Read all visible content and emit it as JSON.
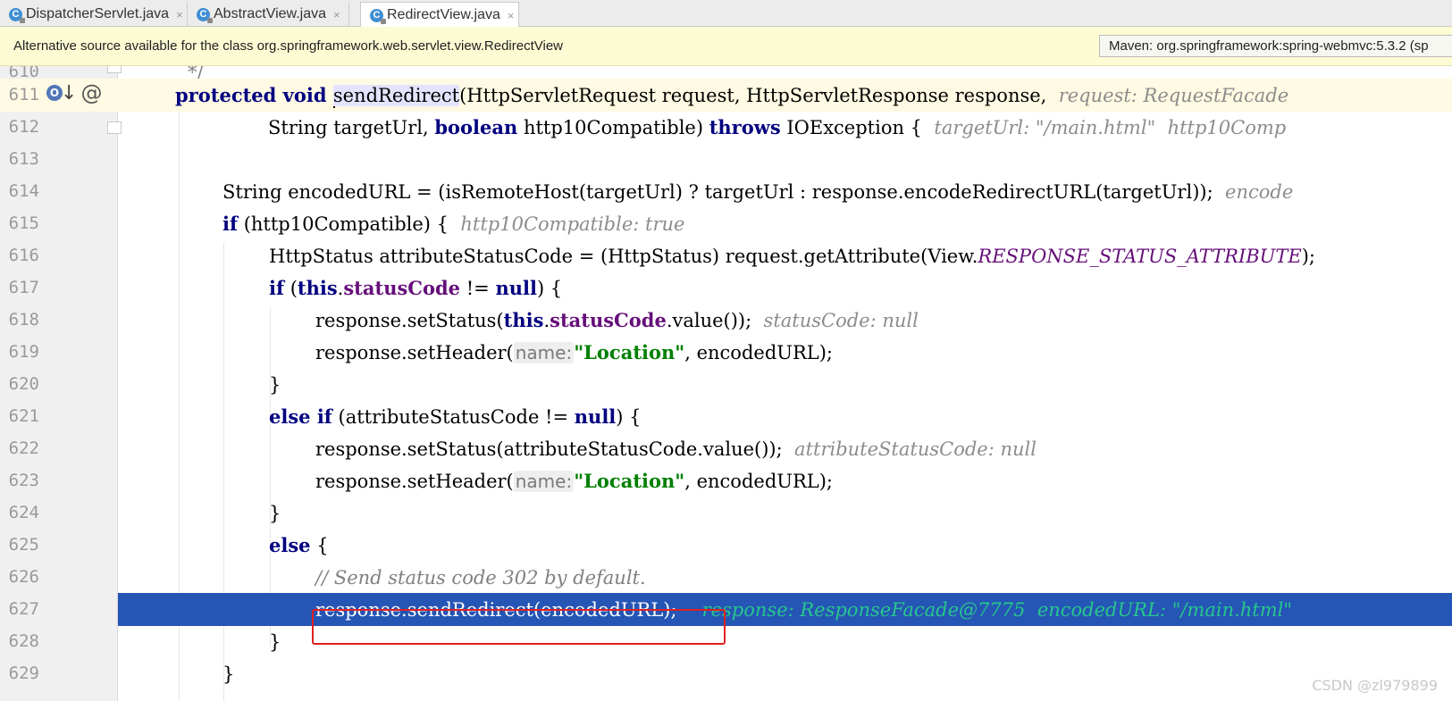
{
  "tabs": [
    {
      "label": "DispatcherServlet.java",
      "icon": "class-icon",
      "active": false
    },
    {
      "label": "AbstractView.java",
      "icon": "class-icon",
      "active": false
    },
    {
      "label": "RedirectView.java",
      "icon": "class-icon",
      "active": true
    }
  ],
  "tab_icon_letter": "C",
  "tab_close_glyph": "×",
  "banner": {
    "message": "Alternative source available for the class org.springframework.web.servlet.view.RedirectView",
    "source_option": "Maven: org.springframework:spring-webmvc:5.3.2 (sp"
  },
  "gutter": {
    "line_numbers": [
      "610",
      "611",
      "612",
      "613",
      "614",
      "615",
      "616",
      "617",
      "618",
      "619",
      "620",
      "621",
      "622",
      "623",
      "624",
      "625",
      "626",
      "627",
      "628",
      "629"
    ],
    "override_icon_letter": "O",
    "override_arrow": "↓",
    "annotation_symbol": "@"
  },
  "code": {
    "l610": "*/",
    "l611_kw": "protected void ",
    "l611_method": "sendRedirect",
    "l611_rest": "(HttpServletRequest request, HttpServletResponse response,  ",
    "l611_hint": "request: RequestFacade",
    "l612_a": "String targetUrl, ",
    "l612_kw1": "boolean",
    "l612_b": " http10Compatible) ",
    "l612_kw2": "throws",
    "l612_c": " IOException {  ",
    "l612_hint": "targetUrl: \"/main.html\"  http10Comp",
    "l614": "String encodedURL = (isRemoteHost(targetUrl) ? targetUrl : response.encodeRedirectURL(targetUrl));  ",
    "l614_hint": "encode",
    "l615_kw": "if",
    "l615_rest": " (http10Compatible) {  ",
    "l615_hint": "http10Compatible: true",
    "l616_a": "HttpStatus attributeStatusCode = (HttpStatus) request.getAttribute(View.",
    "l616_const": "RESPONSE_STATUS_ATTRIBUTE",
    "l616_b": ");",
    "l617_kw": "if",
    "l617_a": " (",
    "l617_this": "this",
    "l617_dot": ".",
    "l617_field": "statusCode",
    "l617_b": " != ",
    "l617_null": "null",
    "l617_c": ") {",
    "l618_a": "response.setStatus(",
    "l618_this": "this",
    "l618_dot": ".",
    "l618_field": "statusCode",
    "l618_b": ".value());  ",
    "l618_hint": "statusCode: null",
    "set_header_a": "response.setHeader(",
    "param_hint": "name:",
    "location_str": "\"Location\"",
    "set_header_b": ", encodedURL);",
    "close_brace": "}",
    "l621_kw": "else if",
    "l621_a": " (attributeStatusCode != ",
    "l621_null": "null",
    "l621_b": ") {",
    "l622": "response.setStatus(attributeStatusCode.value());  ",
    "l622_hint": "attributeStatusCode: null",
    "l625_kw": "else",
    "l625_rest": " {",
    "l626_comment": "// Send status code 302 by default.",
    "l627": "response.sendRedirect(encodedURL);",
    "l627_hint": "response: ResponseFacade@7775  encodedURL: \"/main.html\""
  },
  "watermark": "CSDN @zl979899",
  "colors": {
    "keyword": "#000080",
    "field": "#660e7a",
    "string": "#008000",
    "execution_line": "#2555b5",
    "highlight_box": "#e02020"
  }
}
